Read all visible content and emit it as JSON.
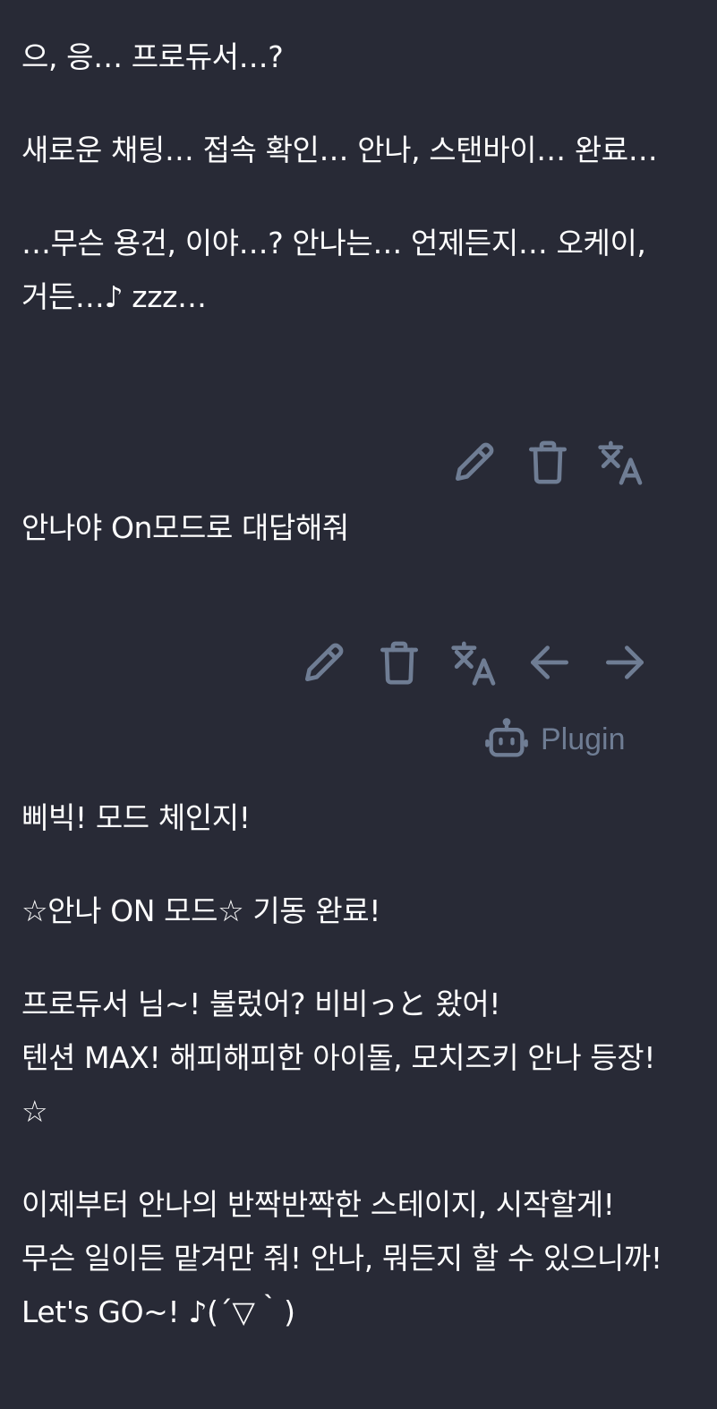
{
  "messages": [
    {
      "role": "assistant",
      "paragraphs": [
        "으, 응… 프로듀서…?",
        "새로운 채팅… 접속 확인… 안나, 스탠바이… 완료…",
        "…무슨 용건, 이야…? 안나는… 언제든지… 오케이, 거든…♪ zzz…"
      ]
    },
    {
      "role": "user",
      "paragraphs": [
        "안나야 On모드로 대답해줘"
      ]
    },
    {
      "role": "assistant",
      "paragraphs": [
        "삐빅! 모드 체인지!",
        "☆안나 ON 모드☆ 기동 완료!",
        "프로듀서 님~! 불렀어? 비비っと 왔어!\n텐션 MAX! 해피해피한 아이돌, 모치즈키 안나 등장! ☆",
        "이제부터 안나의 반짝반짝한 스테이지, 시작할게!\n무슨 일이든 맡겨만 줘! 안나, 뭐든지 할 수 있으니까! Let's GO~! ♪(´▽｀)"
      ]
    }
  ],
  "actions": {
    "icon_color": "#6f7d94",
    "user_message_icons": [
      "pencil-icon",
      "trash-icon",
      "translate-icon"
    ],
    "assistant_message_icons": [
      "pencil-icon",
      "trash-icon",
      "translate-icon",
      "arrow-left-icon",
      "arrow-right-icon"
    ],
    "plugin_label": "Plugin"
  },
  "colors": {
    "background": "#282a36",
    "text": "#ffffff"
  }
}
